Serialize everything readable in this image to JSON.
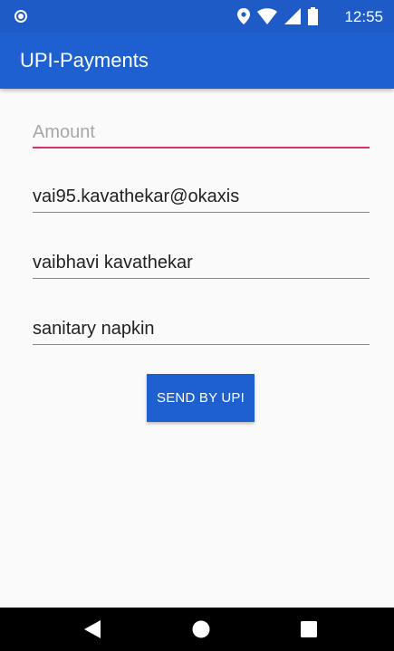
{
  "status_bar": {
    "time": "12:55",
    "icons": [
      "notification-dot-icon",
      "location-icon",
      "wifi-icon",
      "cell-signal-icon",
      "battery-icon"
    ]
  },
  "app_bar": {
    "title": "UPI-Payments"
  },
  "form": {
    "amount": {
      "value": "",
      "placeholder": "Amount"
    },
    "upi_id": {
      "value": "vai95.kavathekar@okaxis",
      "placeholder": ""
    },
    "payee_name": {
      "value": "vaibhavi kavathekar",
      "placeholder": ""
    },
    "note": {
      "value": "sanitary napkin",
      "placeholder": ""
    },
    "send_label": "SEND BY UPI"
  },
  "nav_bar": {
    "buttons": [
      "back-icon",
      "home-icon",
      "recents-icon"
    ]
  },
  "colors": {
    "app_bar": "#1e60d0",
    "status_bar": "#1e5bc6",
    "focus_underline": "#d8316a",
    "background": "#fafafa"
  }
}
